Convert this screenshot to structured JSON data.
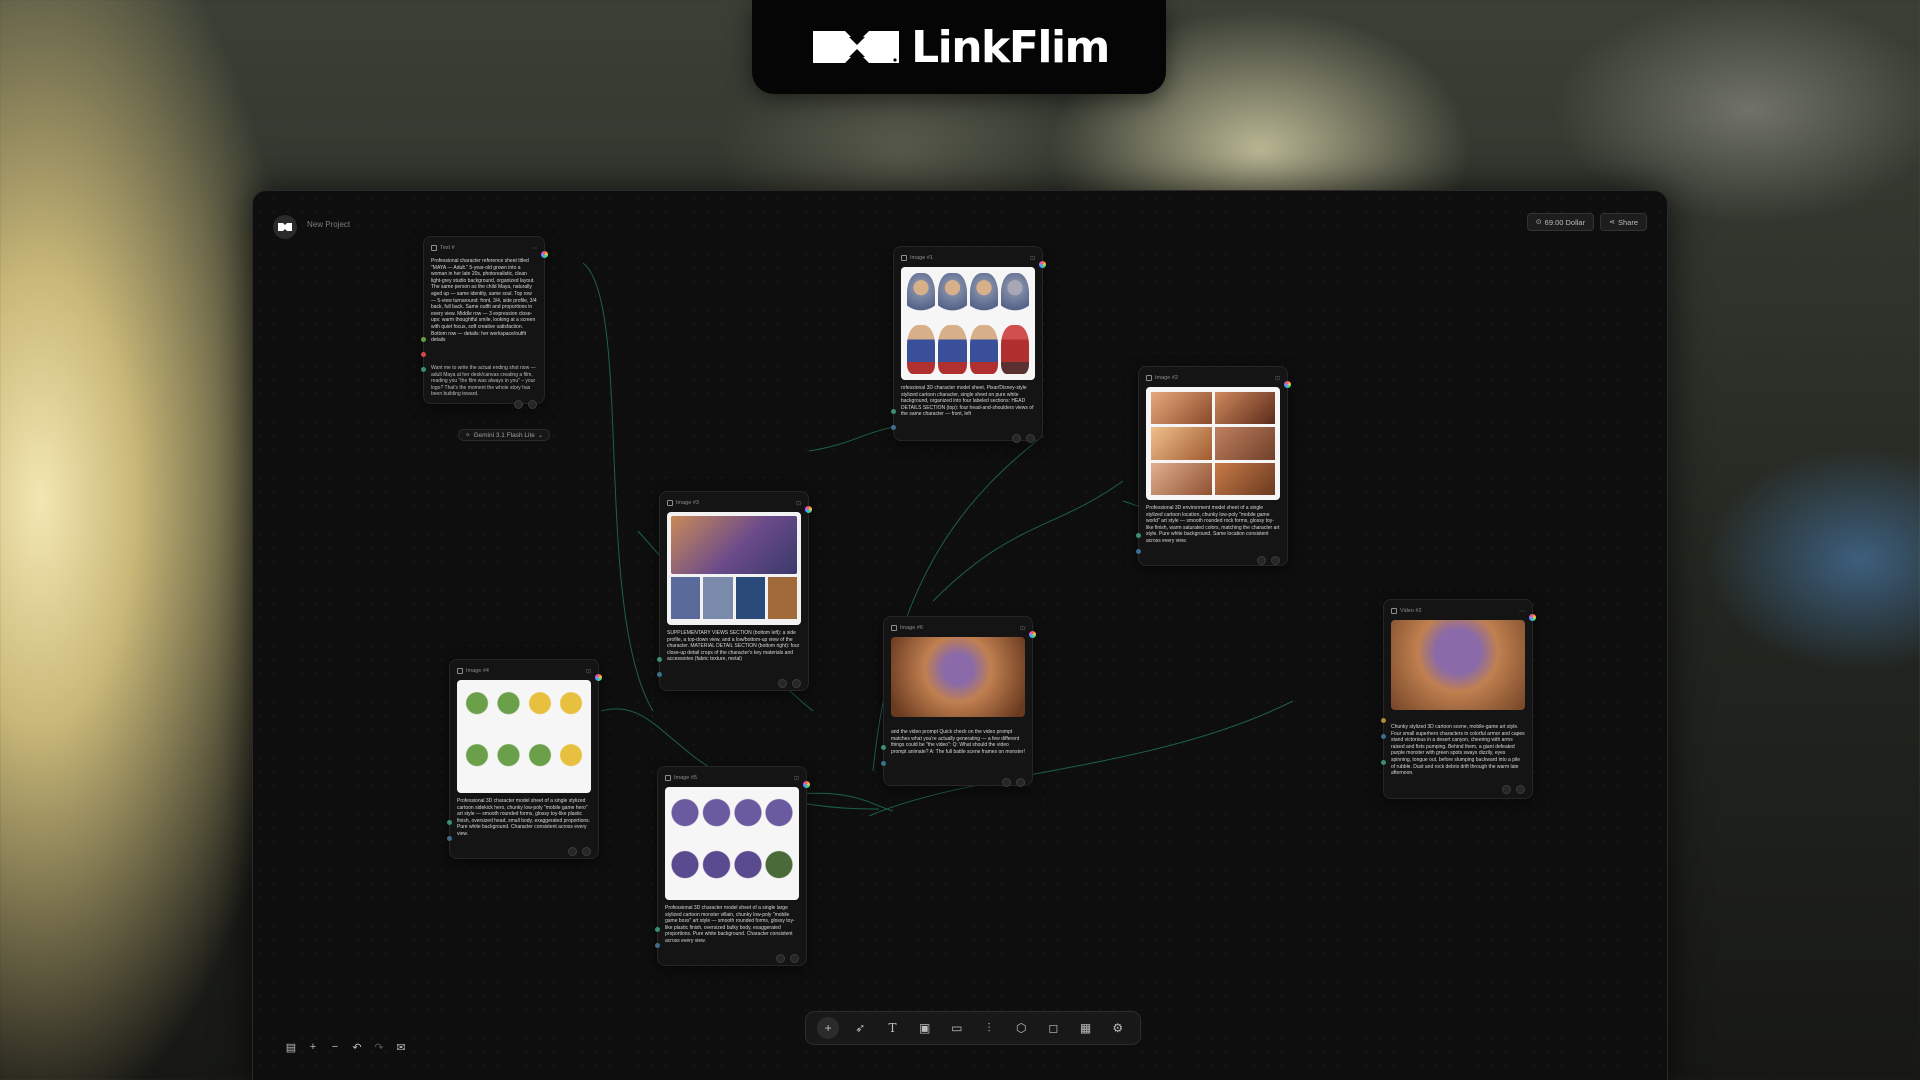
{
  "brand": {
    "name": "LinkFlim",
    "logo_icon": "linkflim-logo-icon"
  },
  "header": {
    "project_name": "New Project",
    "credits": "69.00 Dollar",
    "share_label": "Share"
  },
  "model_label": "Gemini 3.1 Flash Lite",
  "nodes": {
    "text1": {
      "title": "Text #",
      "text": "Professional character reference sheet titled \"MAYA — Adult.\" 5-year-old grown into a woman in her late 20s, photorealistic, clean light-grey studio background, organized layout. The same person as the child Maya, naturally aged up — same identity, same soul. Top row — 5-view turnaround: front, 3/4, side profile, 3/4 back, full back. Same outfit and proportions in every view. Middle row — 3 expression close-ups: warm thoughtful smile, looking at a screen with quiet focus, soft creative satisfaction. Bottom row — details: her workspace/outfit details",
      "text2": "Want me to write the actual ending shot now — adult Maya at her desk/canvas creating a film, reading you \"the film was always in you\" – your logo? That's the moment the whole story has been building toward."
    },
    "image1": {
      "title": "Image #1",
      "text": "rofessional 3D character model sheet, Pixar/Disney-style stylized cartoon character, single sheet on pure white background, organized into four labeled sections: HEAD DETAILS SECTION (top): four head-and-shoulders views of the same character — front, left"
    },
    "image2": {
      "title": "Image #2",
      "text": "Professional 3D environment model sheet of a single stylized cartoon location, chunky low-poly \"mobile game world\" art style — smooth rounded rock forms, glossy toy-like finish, warm saturated colors, matching the character art style. Pure white background. Same location consistent across every view."
    },
    "image3": {
      "title": "Image #3",
      "text": "SUPPLEMENTARY VIEWS SECTION (bottom left): a side profile, a top-down view, and a low/bottom-up view of the character. MATERIAL DETAIL SECTION (bottom right): four close-up detail crops of the character's key materials and accessories (fabric texture, metal)"
    },
    "image4": {
      "title": "Image #4",
      "text": "Professional 3D character model sheet of a single stylized cartoon sidekick hero, chunky low-poly \"mobile game hero\" art style — smooth rounded forms, glossy toy-like plastic finish, oversized head, small body, exaggerated proportions. Pure white background. Character consistent across every view."
    },
    "image5": {
      "title": "Image #5",
      "text": "Professional 3D character model sheet of a single large stylized cartoon monster villain, chunky low-poly \"mobile game boss\" art style — smooth rounded forms, glossy toy-like plastic finish, oversized bulky body, exaggerated proportions. Pure white background. Character consistent across every view."
    },
    "image6": {
      "title": "Image #6",
      "text": "and the video prompt Quick check on the video prompt matches what you're actually generating — a few different things could be \"the video\": Q: What should the video prompt animate? A: The full battle scene frames on monster!"
    },
    "video2": {
      "title": "Video #2",
      "text": "Chunky stylized 3D cartoon scene, mobile-game art style. Four small superhero characters in colorful armor and capes stand victorious in a desert canyon, cheering with arms raised and fists pumping. Behind them, a giant defeated purple monster with green spots sways dizzily, eyes spinning, tongue out, before slumping backward into a pile of rubble. Dust and rock debris drift through the warm late afternoon."
    }
  },
  "toolbar": {
    "tools": [
      "plus-icon",
      "cursor-icon",
      "text-icon",
      "image-icon",
      "video-icon",
      "audio-icon",
      "3d-icon",
      "comment-icon",
      "layout-icon",
      "settings-icon"
    ]
  },
  "colors": {
    "window_bg": "#0e0e0e",
    "node_bg": "#141414",
    "edge": "#1f6b4a",
    "text": "#d8d8d8"
  }
}
